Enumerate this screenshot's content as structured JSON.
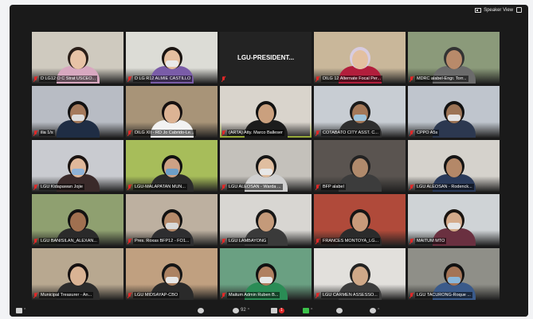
{
  "topbar": {
    "speaker_view_label": "Speaker View"
  },
  "participants": [
    {
      "name": "D LG12 O C Strat USCEO...",
      "muted": true
    },
    {
      "name": "D LG R12 ALMIE CASTILLO",
      "muted": true
    },
    {
      "name": "LGU-PRESIDENT...",
      "muted": true,
      "name_only": true,
      "display": "LGU-PRESIDENT..."
    },
    {
      "name": "DILG 12 Alternate Focal Per...",
      "muted": true
    },
    {
      "name": "MDRC alabel-Engr. Torr...",
      "muted": true
    },
    {
      "name": "ilia 1/s",
      "muted": true
    },
    {
      "name": "DILG XII - RD Jo Cabrido-Le...",
      "muted": true
    },
    {
      "name": "(ARTA) Atty. Marco Balleser",
      "muted": true,
      "active": true
    },
    {
      "name": "COTABATO CITY ASST. C...",
      "muted": true
    },
    {
      "name": "CPPO A5s",
      "muted": true
    },
    {
      "name": "LGU Kidapawan Jojie",
      "muted": true
    },
    {
      "name": "LGU-MALAPATAN MUN...",
      "muted": true
    },
    {
      "name": "LGU ALEOSAN - Warda ...",
      "muted": true
    },
    {
      "name": "BFP alabel",
      "muted": true
    },
    {
      "name": "LGU ALEOSAN - Rodenck...",
      "muted": true
    },
    {
      "name": "LGU BANISILAN_ALEXAN...",
      "muted": true
    },
    {
      "name": "Pres. Roxas BFP12 - FO1...",
      "muted": true
    },
    {
      "name": "LGU LAMBAYONG",
      "muted": true
    },
    {
      "name": "FRANCES MONTOYA_LG...",
      "muted": true
    },
    {
      "name": "MAITUM MTO",
      "muted": true
    },
    {
      "name": "Municipal Treasurer - An...",
      "muted": true
    },
    {
      "name": "LGU MIDSAYAP-CBO",
      "muted": true
    },
    {
      "name": "Maitum Admin Ruben B...",
      "muted": true
    },
    {
      "name": "LGU CARMEN ASSESSO...",
      "muted": true
    },
    {
      "name": "LGU TACURONG-Roque ...",
      "muted": true
    }
  ],
  "bottombar": {
    "participant_count": "92",
    "chat_badge": "1"
  },
  "colors": {
    "active_speaker": "#c5e043",
    "muted": "#e02828",
    "bar": "#1a1a1a"
  }
}
